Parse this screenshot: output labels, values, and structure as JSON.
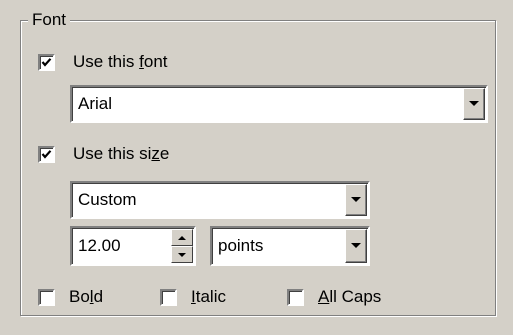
{
  "group": {
    "title": "Font"
  },
  "use_font": {
    "checked": true,
    "label_pre": "Use this ",
    "label_acc": "f",
    "label_post": "ont",
    "value": "Arial"
  },
  "use_size": {
    "checked": true,
    "label_pre": "Use this si",
    "label_acc": "z",
    "label_post": "e",
    "size_value": "Custom",
    "number": "12.00",
    "unit": "points"
  },
  "styles": {
    "bold": {
      "checked": false,
      "pre": "Bo",
      "acc": "l",
      "post": "d"
    },
    "italic": {
      "checked": false,
      "pre": "",
      "acc": "I",
      "post": "talic"
    },
    "allcaps": {
      "checked": false,
      "pre": "",
      "acc": "A",
      "post": "ll Caps"
    }
  },
  "icons": {
    "checkmark": "checkmark-icon",
    "dropdown": "chevron-down-icon",
    "spin_up": "arrow-up-icon",
    "spin_down": "arrow-down-icon"
  }
}
